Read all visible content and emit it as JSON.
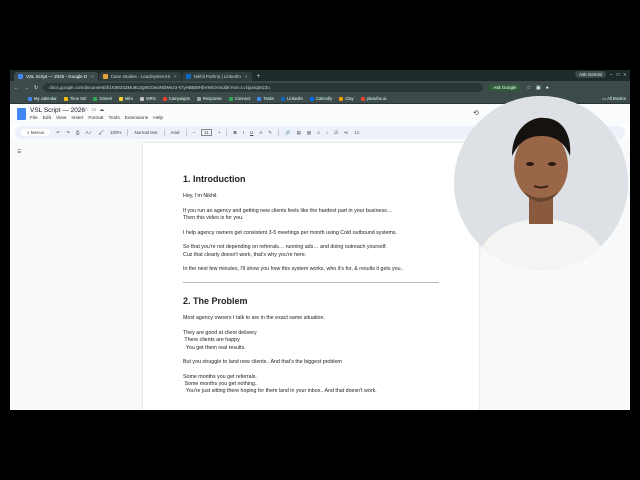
{
  "browser": {
    "tabs": [
      {
        "title": "VSL Script — 2026 - Google D",
        "active": true,
        "color": "#4285f4"
      },
      {
        "title": "Case studies - LeadSystemHi",
        "active": false,
        "color": "#e6a23c"
      },
      {
        "title": "Nikhil Pathria | LinkedIn",
        "active": false,
        "color": "#0a66c2"
      }
    ],
    "new_tab": "+",
    "ask_gemini": "Ask Gemini",
    "url": "docs.google.com/document/d/1Kt9I34ZMu9U2g9GOwaNdWe23-k7yHBBMHbV9vbXvsddKYutr=t.vzpp4q0sz2u",
    "ask_google": "Ask Google",
    "bookmarks": [
      {
        "label": "My calendar",
        "color": "#4285f4"
      },
      {
        "label": "Time Stri",
        "color": "#fbbc04"
      },
      {
        "label": "Gmeet",
        "color": "#34a853"
      },
      {
        "label": "Miro",
        "color": "#ffd02f"
      },
      {
        "label": "MRN",
        "color": "#c4c4c4"
      },
      {
        "label": "Campaigns",
        "color": "#ea4335"
      },
      {
        "label": "Response",
        "color": "#9aa0a6"
      },
      {
        "label": "Connect",
        "color": "#34a853"
      },
      {
        "label": "Tasks",
        "color": "#4285f4"
      },
      {
        "label": "LinkedIn",
        "color": "#0a66c2"
      },
      {
        "label": "Calendly",
        "color": "#006bff"
      },
      {
        "label": "Clay",
        "color": "#f29900"
      },
      {
        "label": "plusvibe.ai",
        "color": "#ea4335"
      }
    ],
    "all_bookmarks": "All Bookm"
  },
  "docs": {
    "title": "VSL Script — 2026",
    "menu": [
      "File",
      "Edit",
      "View",
      "Insert",
      "Format",
      "Tools",
      "Extensions",
      "Help"
    ],
    "search_menus": "Menus",
    "zoom": "100%",
    "style": "Normal text",
    "font": "Arial",
    "font_size": "11"
  },
  "document": {
    "section1_title": "1. Introduction",
    "section1_paras": [
      "Hey, I'm Nikhil.",
      "If you run an agency and getting new clients feels like the hardest part in your business…\nThen this video is for you.",
      "I help agency owners get consistent 3-5 meetings per month using Cold outbound systems.",
      "So that you're not depending on referrals… running ads… and doing outreach yourself.\nCuz that clearly doesn't work, that's why you're here.",
      "In the next few minutes, I'll show you how this system works, who it's for, & results it gets you.."
    ],
    "section2_title": "2. The Problem",
    "section2_paras": [
      "Most agency owners I talk to are in the exact same situation.",
      "They are good at client delivery\n There clients are happy\n  You get them real results.",
      "But you struggle to land new clients.. And that's the biggest problem",
      "Some months you get referrals.\n Some months you get nothing..\n  You're just sitting there hoping for them land in your inbox.. And that doesn't work."
    ]
  }
}
